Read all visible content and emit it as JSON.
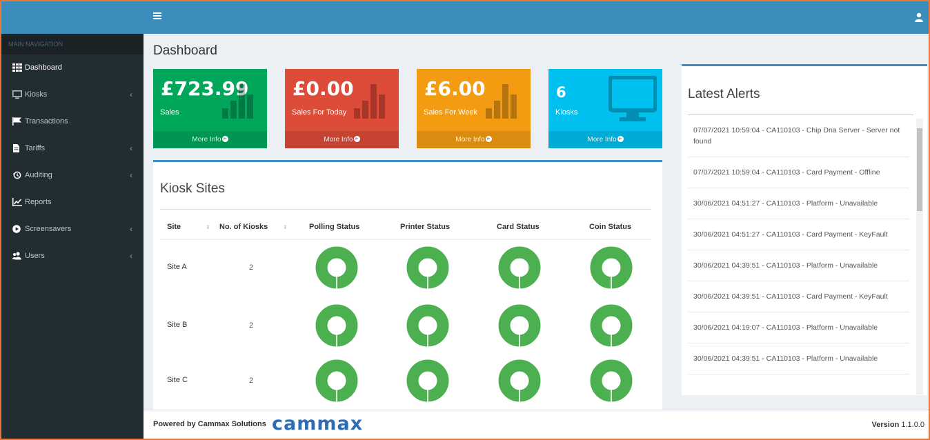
{
  "sidebar": {
    "header": "MAIN NAVIGATION",
    "items": [
      {
        "label": "Dashboard",
        "icon": "dashboard-grid-icon",
        "submenu": false
      },
      {
        "label": "Kiosks",
        "icon": "desktop-icon",
        "submenu": true
      },
      {
        "label": "Transactions",
        "icon": "flag-icon",
        "submenu": false
      },
      {
        "label": "Tariffs",
        "icon": "document-icon",
        "submenu": true
      },
      {
        "label": "Auditing",
        "icon": "history-icon",
        "submenu": true
      },
      {
        "label": "Reports",
        "icon": "chart-icon",
        "submenu": false
      },
      {
        "label": "Screensavers",
        "icon": "play-circle-icon",
        "submenu": true
      },
      {
        "label": "Users",
        "icon": "users-icon",
        "submenu": true
      }
    ]
  },
  "page": {
    "title": "Dashboard"
  },
  "info_boxes": [
    {
      "value": "£723.99",
      "label": "Sales",
      "footer": "More Info",
      "color": "#00a65a",
      "art": "bar-chart-icon"
    },
    {
      "value": "£0.00",
      "label": "Sales For Today",
      "footer": "More Info",
      "color": "#dd4b39",
      "art": "bar-chart-icon"
    },
    {
      "value": "£6.00",
      "label": "Sales For Week",
      "footer": "More Info",
      "color": "#f39c12",
      "art": "bar-chart-icon"
    },
    {
      "value": "6",
      "label": "Kiosks",
      "footer": "More Info",
      "color": "#00c0ef",
      "art": "monitor-icon"
    }
  ],
  "kiosk_sites": {
    "title": "Kiosk Sites",
    "columns": [
      "Site",
      "No. of Kiosks",
      "Polling Status",
      "Printer Status",
      "Card Status",
      "Coin Status"
    ],
    "rows": [
      {
        "site": "Site A",
        "kiosks": "2"
      },
      {
        "site": "Site B",
        "kiosks": "2"
      },
      {
        "site": "Site C",
        "kiosks": "2"
      }
    ],
    "status_color": "#4caf50"
  },
  "alerts": {
    "title": "Latest Alerts",
    "items": [
      "07/07/2021 10:59:04 - CA110103 - Chip Dna Server - Server not found",
      "07/07/2021 10:59:04 - CA110103 - Card Payment - Offline",
      "30/06/2021 04:51:27 - CA110103 - Platform - Unavailable",
      "30/06/2021 04:51:27 - CA110103 - Card Payment - KeyFault",
      "30/06/2021 04:39:51 - CA110103 - Platform - Unavailable",
      "30/06/2021 04:39:51 - CA110103 - Card Payment - KeyFault",
      "30/06/2021 04:19:07 - CA110103 - Platform - Unavailable",
      "30/06/2021 04:39:51 - CA110103 - Platform - Unavailable"
    ]
  },
  "footer": {
    "powered_by": "Powered by Cammax Solutions",
    "brand": "cammax",
    "version_label": "Version",
    "version": "1.1.0.0"
  },
  "colors": {
    "header": "#3c8dbc",
    "sidebar": "#222d32"
  }
}
